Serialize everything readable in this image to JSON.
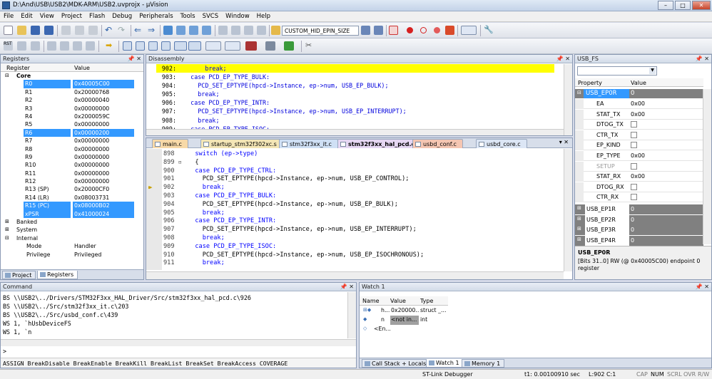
{
  "window": {
    "title": "D:\\And\\USB\\USB2\\MDK-ARM\\USB2.uvprojx - µVision",
    "min": "–",
    "max": "□",
    "close": "✕"
  },
  "menu": [
    "File",
    "Edit",
    "View",
    "Project",
    "Flash",
    "Debug",
    "Peripherals",
    "Tools",
    "SVCS",
    "Window",
    "Help"
  ],
  "toolbar": {
    "config_select": "CUSTOM_HID_EPIN_SIZE"
  },
  "registers": {
    "title": "Registers",
    "col_register": "Register",
    "col_value": "Value",
    "core_label": "Core",
    "rows": [
      {
        "name": "R0",
        "value": "0x40005C00",
        "sel": true
      },
      {
        "name": "R1",
        "value": "0x20000768"
      },
      {
        "name": "R2",
        "value": "0x00000040"
      },
      {
        "name": "R3",
        "value": "0x00000000"
      },
      {
        "name": "R4",
        "value": "0x2000059C"
      },
      {
        "name": "R5",
        "value": "0x00000000"
      },
      {
        "name": "R6",
        "value": "0x00000200",
        "sel": true
      },
      {
        "name": "R7",
        "value": "0x00000000"
      },
      {
        "name": "R8",
        "value": "0x00000000"
      },
      {
        "name": "R9",
        "value": "0x00000000"
      },
      {
        "name": "R10",
        "value": "0x00000000"
      },
      {
        "name": "R11",
        "value": "0x00000000"
      },
      {
        "name": "R12",
        "value": "0x00000000"
      },
      {
        "name": "R13 (SP)",
        "value": "0x20000CF0"
      },
      {
        "name": "R14 (LR)",
        "value": "0x08003731"
      },
      {
        "name": "R15 (PC)",
        "value": "0x08000B02",
        "sel": true
      },
      {
        "name": "xPSR",
        "value": "0x41000024",
        "sel": true
      }
    ],
    "groups": [
      "Banked",
      "System",
      "Internal"
    ],
    "internal": [
      {
        "name": "Mode",
        "value": "Handler"
      },
      {
        "name": "Privilege",
        "value": "Privileged"
      }
    ],
    "tab_project": "Project",
    "tab_registers": "Registers"
  },
  "disassembly": {
    "title": "Disassembly",
    "lines": [
      {
        "n": "902:",
        "t": "        break;",
        "hl": true
      },
      {
        "n": "903:",
        "t": "    case PCD_EP_TYPE_BULK:"
      },
      {
        "n": "904:",
        "t": "      PCD_SET_EPTYPE(hpcd->Instance, ep->num, USB_EP_BULK);"
      },
      {
        "n": "905:",
        "t": "      break;"
      },
      {
        "n": "906:",
        "t": "    case PCD_EP_TYPE_INTR:"
      },
      {
        "n": "907:",
        "t": "      PCD_SET_EPTYPE(hpcd->Instance, ep->num, USB_EP_INTERRUPT);"
      },
      {
        "n": "908:",
        "t": "      break;"
      },
      {
        "n": "909:",
        "t": "    case PCD_EP_TYPE_ISOC:"
      }
    ]
  },
  "editor": {
    "tabs": [
      "main.c",
      "startup_stm32f302xc.s",
      "stm32f3xx_it.c",
      "stm32f3xx_hal_pcd.c",
      "usbd_conf.c",
      "usbd_core.c"
    ],
    "active_tab": 3,
    "lines": [
      {
        "n": "898",
        "t": "  switch (ep->type)"
      },
      {
        "n": "899",
        "t": "  {",
        "fold": "⊟"
      },
      {
        "n": "900",
        "t": "  case PCD_EP_TYPE_CTRL:"
      },
      {
        "n": "901",
        "t": "    PCD_SET_EPTYPE(hpcd->Instance, ep->num, USB_EP_CONTROL);"
      },
      {
        "n": "902",
        "t": "    break;",
        "cur": true
      },
      {
        "n": "903",
        "t": "  case PCD_EP_TYPE_BULK:"
      },
      {
        "n": "904",
        "t": "    PCD_SET_EPTYPE(hpcd->Instance, ep->num, USB_EP_BULK);"
      },
      {
        "n": "905",
        "t": "    break;"
      },
      {
        "n": "906",
        "t": "  case PCD_EP_TYPE_INTR:"
      },
      {
        "n": "907",
        "t": "    PCD_SET_EPTYPE(hpcd->Instance, ep->num, USB_EP_INTERRUPT);"
      },
      {
        "n": "908",
        "t": "    break;"
      },
      {
        "n": "909",
        "t": "  case PCD_EP_TYPE_ISOC:"
      },
      {
        "n": "910",
        "t": "    PCD_SET_EPTYPE(hpcd->Instance, ep->num, USB_EP_ISOCHRONOUS);"
      },
      {
        "n": "911",
        "t": "    break;"
      }
    ]
  },
  "usb_fs": {
    "title": "USB_FS",
    "col_property": "Property",
    "col_value": "Value",
    "ep0r": {
      "name": "USB_EP0R",
      "value": "0"
    },
    "fields": [
      {
        "name": "EA",
        "value": "0x00",
        "type": "text"
      },
      {
        "name": "STAT_TX",
        "value": "0x00",
        "type": "text"
      },
      {
        "name": "DTOG_TX",
        "value": "",
        "type": "cb"
      },
      {
        "name": "CTR_TX",
        "value": "",
        "type": "cb"
      },
      {
        "name": "EP_KIND",
        "value": "",
        "type": "cb"
      },
      {
        "name": "EP_TYPE",
        "value": "0x00",
        "type": "text"
      },
      {
        "name": "SETUP",
        "value": "",
        "type": "cb",
        "dim": true
      },
      {
        "name": "STAT_RX",
        "value": "0x00",
        "type": "text"
      },
      {
        "name": "DTOG_RX",
        "value": "",
        "type": "cb"
      },
      {
        "name": "CTR_RX",
        "value": "",
        "type": "cb"
      }
    ],
    "others": [
      {
        "name": "USB_EP1R",
        "value": "0"
      },
      {
        "name": "USB_EP2R",
        "value": "0"
      },
      {
        "name": "USB_EP3R",
        "value": "0"
      },
      {
        "name": "USB_EP4R",
        "value": "0"
      }
    ],
    "desc_title": "USB_EP0R",
    "desc_text": "[Bits 31..0] RW (@ 0x40005C00) endpoint 0 register"
  },
  "command": {
    "title": "Command",
    "lines": [
      "BS \\\\USB2\\../Drivers/STM32F3xx_HAL_Driver/Src/stm32f3xx_hal_pcd.c\\926",
      "BS \\\\USB2\\../Src/stm32f3xx_it.c\\203",
      "BS \\\\USB2\\../Src/usbd_conf.c\\439",
      "WS 1, `hUsbDeviceFS",
      "WS 1, `n"
    ],
    "prompt": ">",
    "hint": "ASSIGN BreakDisable BreakEnable BreakKill BreakList BreakSet BreakAccess COVERAGE"
  },
  "watch": {
    "title": "Watch 1",
    "col_name": "Name",
    "col_value": "Value",
    "col_type": "Type",
    "rows": [
      {
        "name": "h...",
        "value": "0x20000...",
        "type": "struct _..."
      },
      {
        "name": "n",
        "value": "<not in...",
        "type": "int"
      },
      {
        "name": "<En...",
        "value": "",
        "type": ""
      }
    ],
    "tabs": [
      "Call Stack + Locals",
      "Watch 1",
      "Memory 1"
    ]
  },
  "status": {
    "debugger": "ST-Link Debugger",
    "time": "t1: 0.00100910 sec",
    "pos": "L:902 C:1",
    "caps": "CAP",
    "num": "NUM",
    "scrl": "SCRL",
    "ovr": "OVR",
    "rw": "R/W"
  }
}
